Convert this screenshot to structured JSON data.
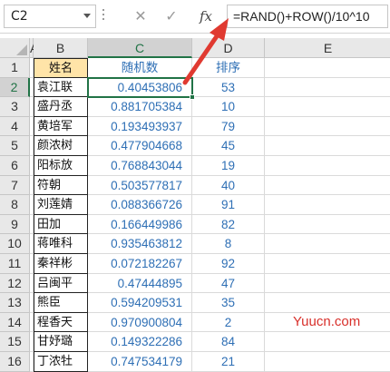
{
  "formula_bar": {
    "name_box": "C2",
    "cancel_glyph": "✕",
    "confirm_glyph": "✓",
    "fx_label": "fx",
    "formula": "=RAND()+ROW()/10^10"
  },
  "columns": [
    "A",
    "B",
    "C",
    "D",
    "E"
  ],
  "header_row": {
    "row": "1",
    "name": "姓名",
    "rand": "随机数",
    "rank": "排序"
  },
  "rows": [
    {
      "row": "2",
      "name": "袁江联",
      "rand": "0.40453806",
      "rank": "53"
    },
    {
      "row": "3",
      "name": "盛丹丞",
      "rand": "0.881705384",
      "rank": "10"
    },
    {
      "row": "4",
      "name": "黄培军",
      "rand": "0.193493937",
      "rank": "79"
    },
    {
      "row": "5",
      "name": "颜浓树",
      "rand": "0.477904668",
      "rank": "45"
    },
    {
      "row": "6",
      "name": "阳标放",
      "rand": "0.768843044",
      "rank": "19"
    },
    {
      "row": "7",
      "name": "符朝",
      "rand": "0.503577817",
      "rank": "40"
    },
    {
      "row": "8",
      "name": "刘莲婧",
      "rand": "0.088366726",
      "rank": "91"
    },
    {
      "row": "9",
      "name": "田加",
      "rand": "0.166449986",
      "rank": "82"
    },
    {
      "row": "10",
      "name": "蒋唯科",
      "rand": "0.935463812",
      "rank": "8"
    },
    {
      "row": "11",
      "name": "秦祥彬",
      "rand": "0.072182267",
      "rank": "92"
    },
    {
      "row": "12",
      "name": "吕闽平",
      "rand": "0.47444895",
      "rank": "47"
    },
    {
      "row": "13",
      "name": "熊臣",
      "rand": "0.594209531",
      "rank": "35"
    },
    {
      "row": "14",
      "name": "程香天",
      "rand": "0.970900804",
      "rank": "2"
    },
    {
      "row": "15",
      "name": "甘妤璐",
      "rand": "0.149322286",
      "rank": "84"
    },
    {
      "row": "16",
      "name": "丁浓牡",
      "rand": "0.747534179",
      "rank": "21"
    }
  ],
  "watermark": "Yuucn.com",
  "colors": {
    "accent": "#217346",
    "value_text": "#2e6fb5",
    "header_fill": "#ffe4a8",
    "arrow": "#e03a31"
  }
}
